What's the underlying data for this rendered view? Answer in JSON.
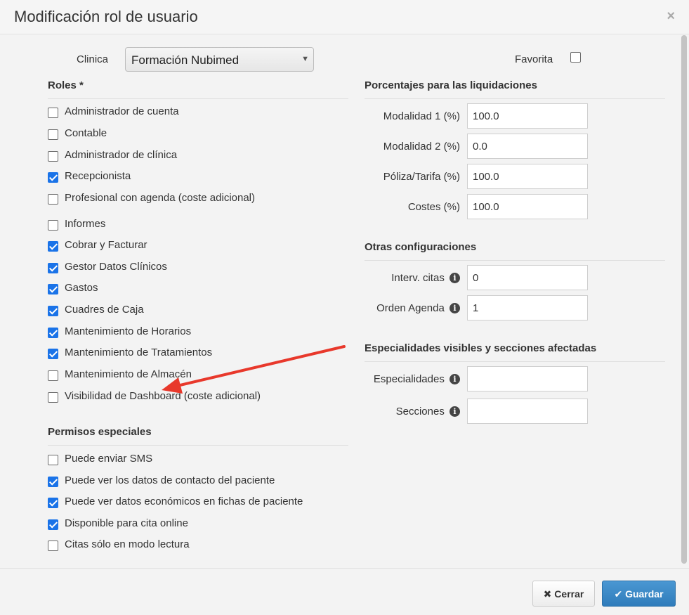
{
  "modal": {
    "title": "Modificación rol de usuario",
    "close_symbol": "×"
  },
  "clinic": {
    "label": "Clinica",
    "selected": "Formación Nubimed",
    "favorite_label": "Favorita",
    "favorite_checked": false
  },
  "roles": {
    "title": "Roles *",
    "items": [
      {
        "label": "Administrador de cuenta",
        "checked": false
      },
      {
        "label": "Contable",
        "checked": false
      },
      {
        "label": "Administrador de clínica",
        "checked": false
      },
      {
        "label": "Recepcionista",
        "checked": true
      },
      {
        "label": "Profesional con agenda (coste adicional)",
        "checked": false
      },
      {
        "label": "Informes",
        "checked": false
      },
      {
        "label": "Cobrar y Facturar",
        "checked": true
      },
      {
        "label": "Gestor Datos Clínicos",
        "checked": true
      },
      {
        "label": "Gastos",
        "checked": true
      },
      {
        "label": "Cuadres de Caja",
        "checked": true
      },
      {
        "label": "Mantenimiento de Horarios",
        "checked": true
      },
      {
        "label": "Mantenimiento de Tratamientos",
        "checked": true
      },
      {
        "label": "Mantenimiento de Almacén",
        "checked": false
      },
      {
        "label": "Visibilidad de Dashboard (coste adicional)",
        "checked": false
      }
    ]
  },
  "special": {
    "title": "Permisos especiales",
    "items": [
      {
        "label": "Puede enviar SMS",
        "checked": false
      },
      {
        "label": "Puede ver los datos de contacto del paciente",
        "checked": true
      },
      {
        "label": "Puede ver datos económicos en fichas de paciente",
        "checked": true
      },
      {
        "label": "Disponible para cita online",
        "checked": true
      },
      {
        "label": "Citas sólo en modo lectura",
        "checked": false
      }
    ]
  },
  "percentages": {
    "title": "Porcentajes para las liquidaciones",
    "fields": [
      {
        "label": "Modalidad 1 (%)",
        "value": "100.0"
      },
      {
        "label": "Modalidad 2 (%)",
        "value": "0.0"
      },
      {
        "label": "Póliza/Tarifa (%)",
        "value": "100.0"
      },
      {
        "label": "Costes (%)",
        "value": "100.0"
      }
    ]
  },
  "other": {
    "title": "Otras configuraciones",
    "fields": [
      {
        "label": "Interv. citas",
        "value": "0"
      },
      {
        "label": "Orden Agenda",
        "value": "1"
      }
    ]
  },
  "specialties": {
    "title": "Especialidades visibles y secciones afectadas",
    "fields": [
      {
        "label": "Especialidades",
        "value": ""
      },
      {
        "label": "Secciones",
        "value": ""
      }
    ]
  },
  "footer": {
    "close_label": "Cerrar",
    "save_label": "Guardar"
  },
  "colors": {
    "accent": "#1a73e8",
    "save_button": "#3a88c8",
    "annotation_arrow": "#e8382b"
  },
  "icons": {
    "info": "info-icon",
    "close": "close-icon",
    "check": "check-icon",
    "times": "times-icon",
    "dropdown": "chevron-down-icon"
  }
}
